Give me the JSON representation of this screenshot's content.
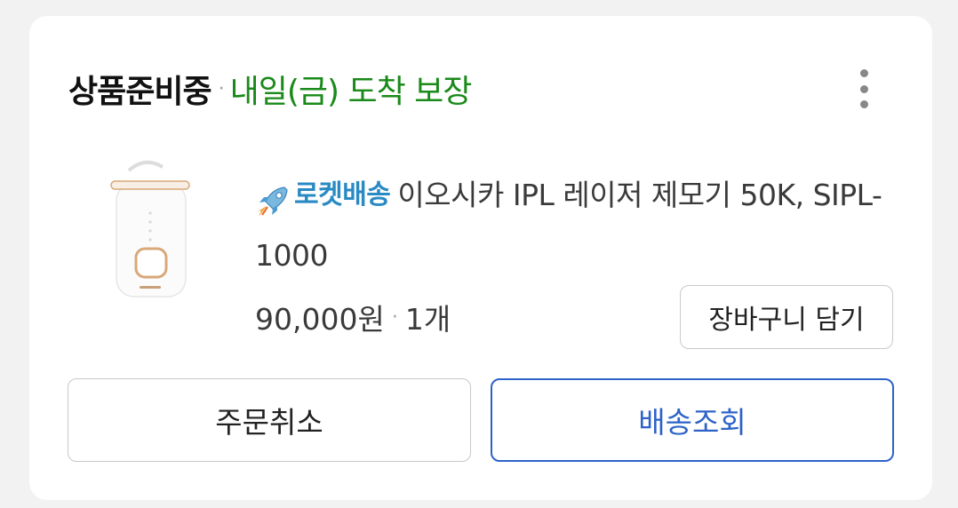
{
  "order": {
    "status": "상품준비중",
    "separator": "·",
    "delivery_promise": "내일(금) 도착 보장",
    "more_icon": "more-vertical-icon"
  },
  "product": {
    "badge_icon": "rocket-icon",
    "badge_label": "로켓배송",
    "name": "이오시카 IPL 레이저 제모기 50K, SIPL-1000",
    "image_alt": "IPL hair removal device",
    "price": "90,000원",
    "separator": "·",
    "quantity": "1개"
  },
  "actions": {
    "add_to_cart": "장바구니 담기",
    "cancel_order": "주문취소",
    "track_delivery": "배송조회"
  },
  "colors": {
    "delivery_green": "#1a8a1a",
    "rocket_blue": "#2a8ac4",
    "primary_blue": "#2d63c8"
  }
}
